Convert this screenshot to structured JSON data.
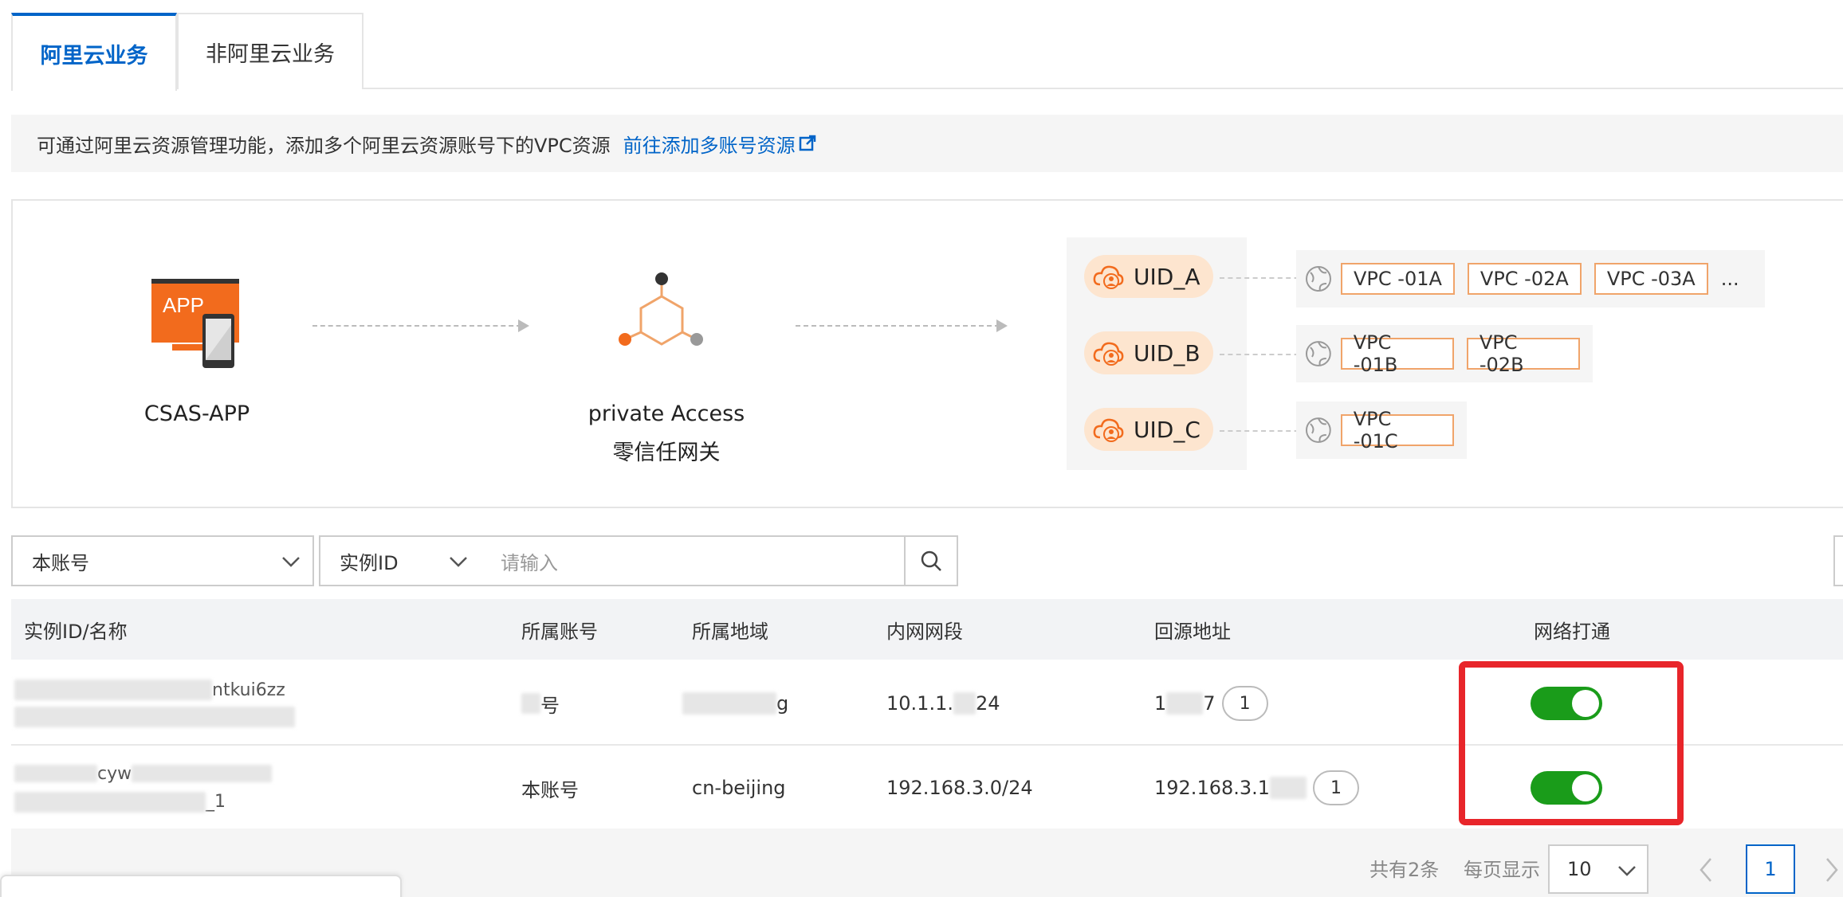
{
  "tabs": [
    {
      "label": "阿里云业务",
      "active": true
    },
    {
      "label": "非阿里云业务",
      "active": false
    }
  ],
  "notice": {
    "text": "可通过阿里云资源管理功能，添加多个阿里云资源账号下的VPC资源",
    "link": "前往添加多账号资源"
  },
  "diagram": {
    "app": {
      "badge": "APP",
      "label": "CSAS-APP"
    },
    "gateway": {
      "line1": "private Access",
      "line2": "零信任网关"
    },
    "uids": [
      {
        "label": "UID_A",
        "vpcs": [
          "VPC -01A",
          "VPC -02A",
          "VPC -03A"
        ],
        "more": "..."
      },
      {
        "label": "UID_B",
        "vpcs": [
          "VPC -01B",
          "VPC -02B"
        ]
      },
      {
        "label": "UID_C",
        "vpcs": [
          "VPC -01C"
        ]
      }
    ]
  },
  "filters": {
    "account_select": "本账号",
    "field_select": "实例ID",
    "search_placeholder": "请输入"
  },
  "table": {
    "headers": [
      "实例ID/名称",
      "所属账号",
      "所属地域",
      "内网网段",
      "回源地址",
      "网络打通"
    ],
    "rows": [
      {
        "id_line1": "ntkui6zz",
        "account": "号",
        "region": "g",
        "cidr": "10.1.1.",
        "cidr_suffix": "24",
        "origin": "1",
        "origin_suffix": "7",
        "count": "1",
        "enabled": true
      },
      {
        "id_line1": "cyw",
        "id_line2": "_1",
        "account": "本账号",
        "region": "cn-beijing",
        "cidr": "192.168.3.0/24",
        "origin": "192.168.3.1",
        "count": "1",
        "enabled": true
      }
    ]
  },
  "pagination": {
    "total": "共有2条",
    "per_page_label": "每页显示",
    "per_page": "10",
    "current_page": "1"
  },
  "colors": {
    "primary": "#0064c8",
    "toggle_on": "#1a9c1a",
    "highlight": "#e8252a",
    "uid_pill": "#fde5cf",
    "vpc_border": "#f0a46a",
    "app_orange": "#f26b1d"
  }
}
